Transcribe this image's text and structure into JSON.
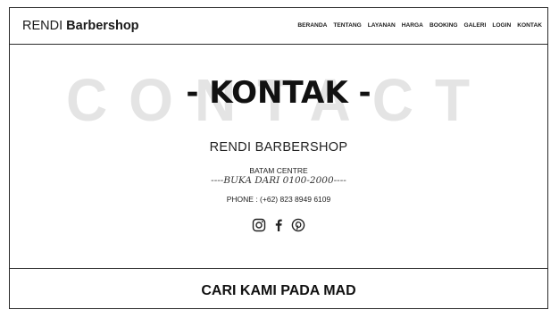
{
  "header": {
    "brand_prefix": "RENDI",
    "brand_name": "Barbershop",
    "nav": [
      "BERANDA",
      "TENTANG",
      "LAYANAN",
      "HARGA",
      "BOOKING",
      "GALERI",
      "LOGIN",
      "KONTAK"
    ]
  },
  "contact": {
    "background_word": "CONTACT",
    "title": "- KONTAK -",
    "shop_name": "RENDI BARBERSHOP",
    "address": "BATAM CENTRE",
    "hours": "----BUKA DARI 0100-2000----",
    "phone": "PHONE : (+62) 823 8949 6109",
    "social_icons": [
      "instagram-icon",
      "facebook-icon",
      "pinterest-icon"
    ]
  },
  "map_section": {
    "title": "CARI KAMI PADA MAD"
  }
}
